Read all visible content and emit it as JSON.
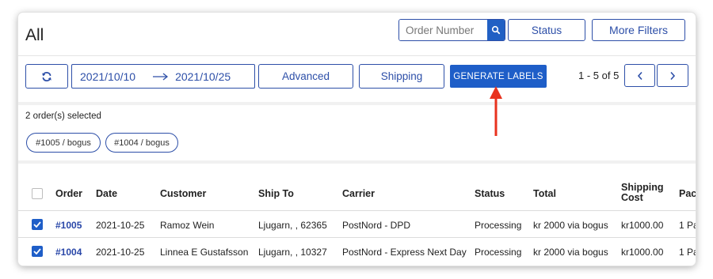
{
  "header": {
    "title": "All",
    "order_search": {
      "placeholder": "Order Number"
    },
    "status_label": "Status",
    "more_filters_label": "More Filters"
  },
  "toolbar": {
    "refresh_icon": "refresh-icon",
    "date_from": "2021/10/10",
    "date_to": "2021/10/25",
    "advanced_label": "Advanced",
    "shipping_label": "Shipping",
    "generate_labels_label": "GENERATE LABELS",
    "pager_text": "1 - 5 of 5"
  },
  "selection": {
    "text": "2 order(s) selected",
    "chips": [
      "#1005 / bogus",
      "#1004 / bogus"
    ]
  },
  "table": {
    "headers": {
      "order": "Order",
      "date": "Date",
      "customer": "Customer",
      "ship_to": "Ship To",
      "carrier": "Carrier",
      "status": "Status",
      "total": "Total",
      "shipping_cost_1": "Shipping",
      "shipping_cost_2": "Cost",
      "packages": "Pac"
    },
    "rows": [
      {
        "order": "#1005",
        "date": "2021-10-25",
        "customer": "Ramoz Wein",
        "ship_to": "Ljugarn, , 62365",
        "carrier": "PostNord - DPD",
        "status": "Processing",
        "total": "kr 2000 via bogus",
        "shipping_cost": "kr1000.00",
        "packages": "1 Pa"
      },
      {
        "order": "#1004",
        "date": "2021-10-25",
        "customer": "Linnea E Gustafsson",
        "ship_to": "Ljugarn, , 10327",
        "carrier": "PostNord - Express Next Day",
        "status": "Processing",
        "total": "kr 2000 via bogus",
        "shipping_cost": "kr1000.00",
        "packages": "1 Pa"
      }
    ]
  },
  "colors": {
    "accent": "#2d4fa8",
    "primary_button": "#1e5ec8",
    "annotation_arrow": "#e8321e"
  }
}
